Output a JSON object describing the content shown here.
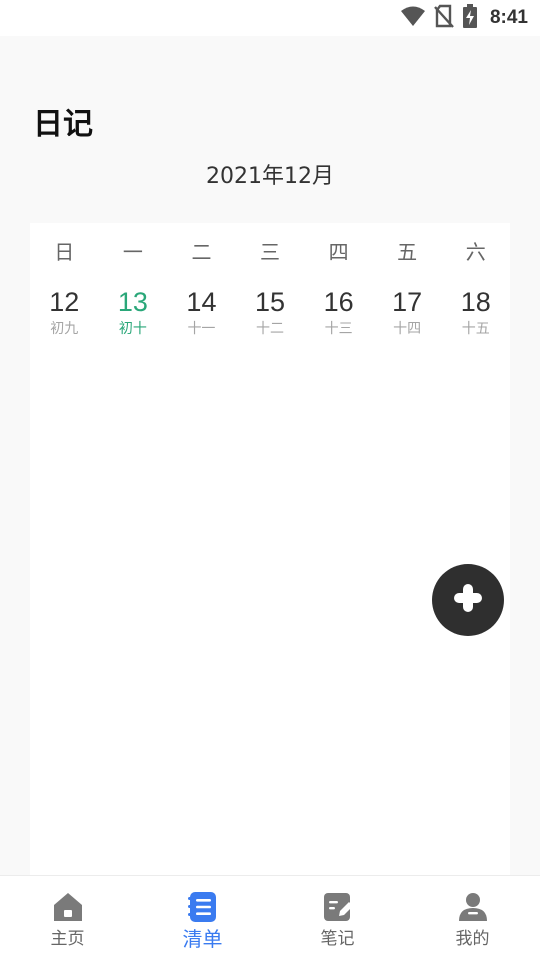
{
  "status_bar": {
    "time": "8:41",
    "icons": [
      "wifi-icon",
      "no-sim-icon",
      "battery-charging-icon"
    ]
  },
  "header": {
    "title": "日记",
    "month": "2021年12月"
  },
  "calendar": {
    "weekdays": [
      "日",
      "一",
      "二",
      "三",
      "四",
      "五",
      "六"
    ],
    "dates": [
      {
        "day": "12",
        "lunar": "初九",
        "today": false
      },
      {
        "day": "13",
        "lunar": "初十",
        "today": true
      },
      {
        "day": "14",
        "lunar": "十一",
        "today": false
      },
      {
        "day": "15",
        "lunar": "十二",
        "today": false
      },
      {
        "day": "16",
        "lunar": "十三",
        "today": false
      },
      {
        "day": "17",
        "lunar": "十四",
        "today": false
      },
      {
        "day": "18",
        "lunar": "十五",
        "today": false
      }
    ],
    "today_color": "#2aa779"
  },
  "fab": {
    "icon": "plus-icon",
    "color": "#2f2f2f"
  },
  "bottom_nav": {
    "active_color": "#3a7bf0",
    "items": [
      {
        "label": "主页",
        "icon": "home-icon",
        "active": false
      },
      {
        "label": "清单",
        "icon": "list-icon",
        "active": true
      },
      {
        "label": "笔记",
        "icon": "note-edit-icon",
        "active": false
      },
      {
        "label": "我的",
        "icon": "user-icon",
        "active": false
      }
    ]
  }
}
